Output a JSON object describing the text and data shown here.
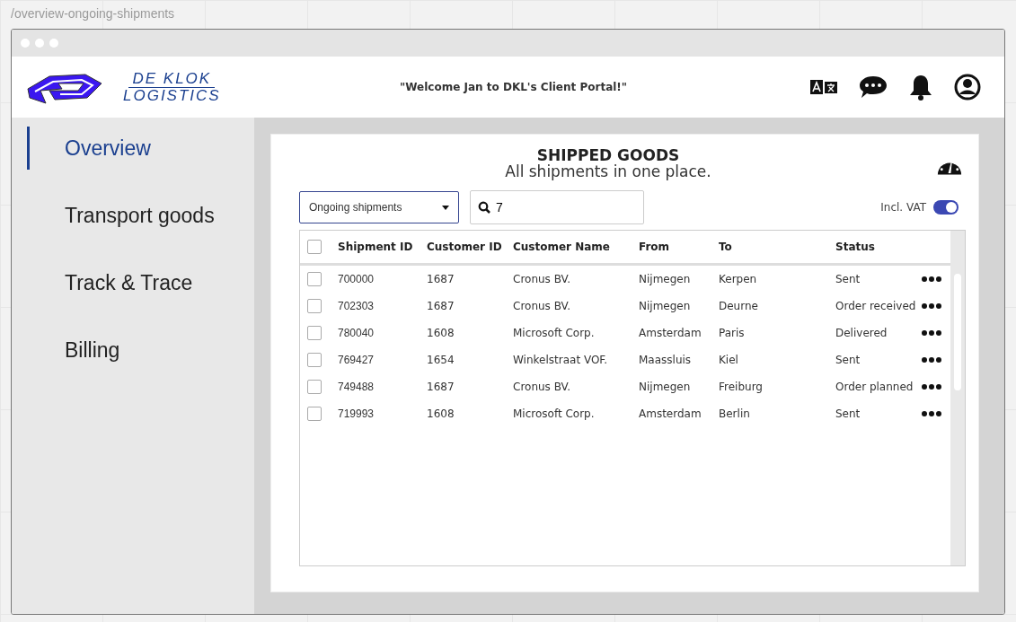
{
  "route": "/overview-ongoing-shipments",
  "brand": {
    "line_1": "DE KLOK",
    "line_2": "LOGISTICS"
  },
  "header": {
    "welcome": "\"Welcome Jan to DKL's Client Portal!\""
  },
  "sidebar": {
    "items": [
      {
        "label": "Overview",
        "selected": true
      },
      {
        "label": "Transport goods",
        "selected": false
      },
      {
        "label": "Track & Trace",
        "selected": false
      },
      {
        "label": "Billing",
        "selected": false
      }
    ]
  },
  "content": {
    "title": "SHIPPED GOODS",
    "subtitle": "All shipments in one place.",
    "filter": {
      "value": "Ongoing shipments"
    },
    "search": {
      "value": "7"
    },
    "vat_toggle": {
      "label": "Incl. VAT",
      "on": true
    },
    "table": {
      "select_all_checked": false,
      "columns": [
        "Shipment ID",
        "Customer ID",
        "Customer Name",
        "From",
        "To",
        "Status"
      ],
      "rows": [
        {
          "checked": false,
          "cells": [
            "700000",
            "1687",
            "Cronus BV.",
            "Nijmegen",
            "Kerpen",
            "Sent"
          ]
        },
        {
          "checked": false,
          "cells": [
            "702303",
            "1687",
            "Cronus BV.",
            "Nijmegen",
            "Deurne",
            "Order received"
          ]
        },
        {
          "checked": false,
          "cells": [
            "780040",
            "1608",
            "Microsoft Corp.",
            "Amsterdam",
            "Paris",
            "Delivered"
          ]
        },
        {
          "checked": false,
          "cells": [
            "769427",
            "1654",
            "Winkelstraat VOF.",
            "Maassluis",
            "Kiel",
            "Sent"
          ]
        },
        {
          "checked": false,
          "cells": [
            "749488",
            "1687",
            "Cronus BV.",
            "Nijmegen",
            "Freiburg",
            "Order planned"
          ]
        },
        {
          "checked": false,
          "cells": [
            "719993",
            "1608",
            "Microsoft Corp.",
            "Amsterdam",
            "Berlin",
            "Sent"
          ]
        }
      ]
    }
  }
}
